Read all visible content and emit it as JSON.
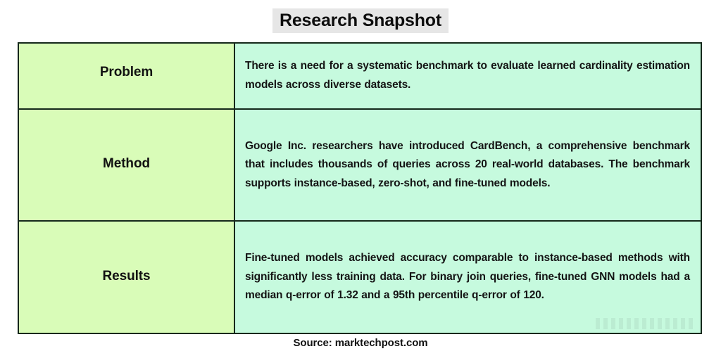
{
  "title": "Research Snapshot",
  "table": {
    "rows": [
      {
        "label": "Problem",
        "body": "There is a need for a systematic benchmark to evaluate learned cardinality estimation models across diverse datasets."
      },
      {
        "label": "Method",
        "body": "Google Inc. researchers have introduced CardBench, a comprehensive benchmark that includes thousands of queries across 20 real-world databases. The benchmark supports instance-based, zero-shot, and fine-tuned models."
      },
      {
        "label": "Results",
        "body": "Fine-tuned models achieved accuracy comparable to instance-based methods with significantly less training data. For binary join queries, fine-tuned GNN models had a median q-error of 1.32 and a 95th percentile q-error of 120."
      }
    ]
  },
  "footer": {
    "source": "Source: marktechpost.com"
  },
  "colors": {
    "label_column_bg": "#d9fcb8",
    "body_column_bg": "#c6fade",
    "border": "#15281b",
    "title_highlight": "#e6e6e6",
    "text": "#111111",
    "page_bg": "#ffffff"
  }
}
